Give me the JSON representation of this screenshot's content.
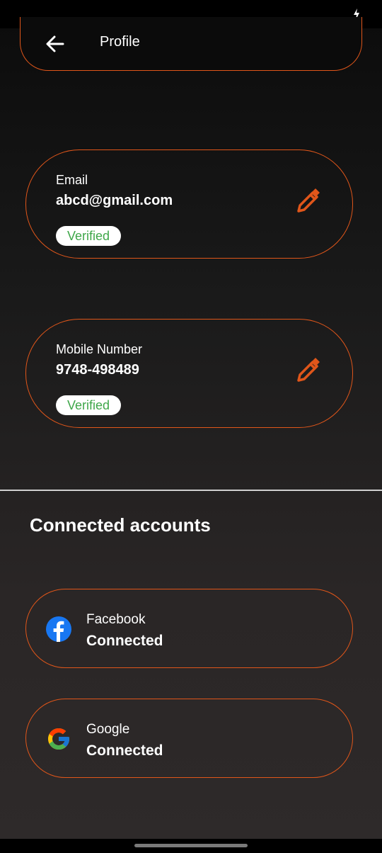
{
  "header": {
    "title": "Profile"
  },
  "email_card": {
    "label": "Email",
    "value": "abcd@gmail.com",
    "badge": "Verified"
  },
  "mobile_card": {
    "label": "Mobile Number",
    "value": "9748-498489",
    "badge": "Verified"
  },
  "connected_accounts": {
    "title": "Connected accounts",
    "items": [
      {
        "name": "Facebook",
        "status": "Connected",
        "icon": "facebook-icon"
      },
      {
        "name": "Google",
        "status": "Connected",
        "icon": "google-icon"
      }
    ]
  },
  "colors": {
    "accent": "#e0561a",
    "verified_text": "#3fa74a",
    "background": "#1a1a1a"
  }
}
